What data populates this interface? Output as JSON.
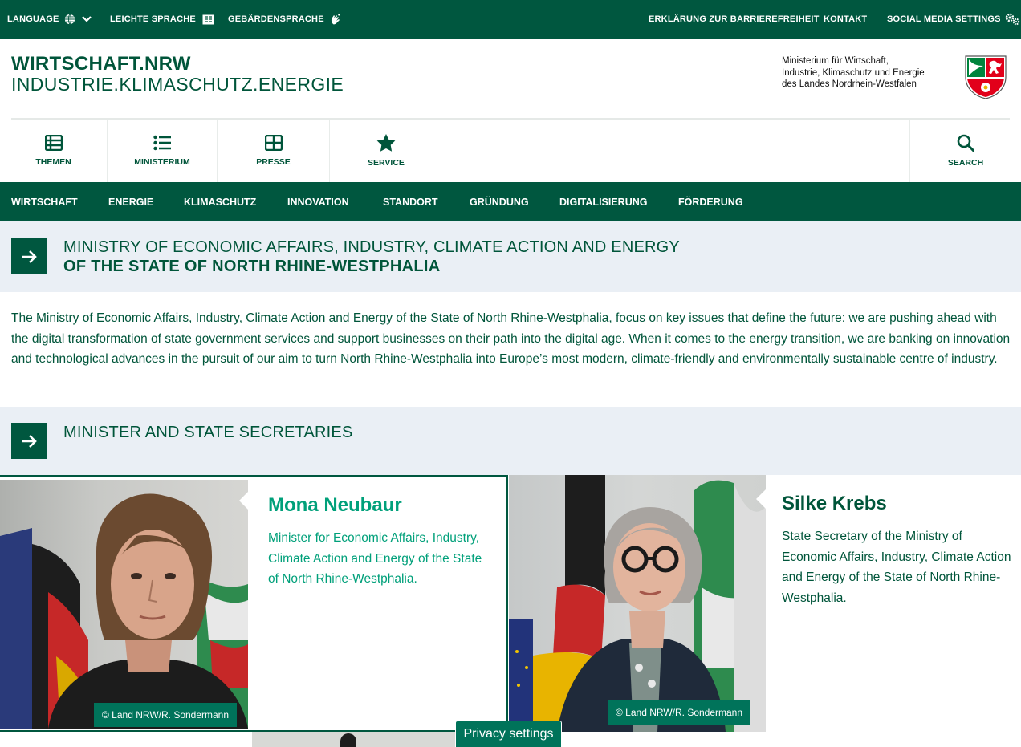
{
  "topbar": {
    "language": "LANGUAGE",
    "easy_language": "LEICHTE SPRACHE",
    "sign_language": "GEBÄRDENSPRACHE",
    "accessibility": "ERKLÄRUNG ZUR BARRIEREFREIHEIT",
    "contact": "KONTAKT",
    "social_media": "SOCIAL MEDIA SETTINGS"
  },
  "header": {
    "brand_line1": "WIRTSCHAFT.NRW",
    "brand_line2": "INDUSTRIE.KLIMASCHUTZ.ENERGIE",
    "ministry_line1": "Ministerium für Wirtschaft,",
    "ministry_line2": "Industrie, Klimaschutz und Energie",
    "ministry_line3": "des Landes Nordrhein-Westfalen"
  },
  "icon_nav": {
    "themen": "THEMEN",
    "ministerium": "MINISTERIUM",
    "presse": "PRESSE",
    "service": "SERVICE",
    "search": "SEARCH"
  },
  "sub_nav": [
    "WIRTSCHAFT",
    "ENERGIE",
    "KLIMASCHUTZ",
    "INNOVATION",
    "STANDORT",
    "GRÜNDUNG",
    "DIGITALISIERUNG",
    "FÖRDERUNG"
  ],
  "section1": {
    "title_line1": "MINISTRY OF ECONOMIC AFFAIRS, INDUSTRY, CLIMATE ACTION AND ENERGY",
    "title_line2": "OF THE STATE OF NORTH RHINE-WESTPHALIA"
  },
  "intro_text": "The Ministry of Economic Affairs, Industry, Climate Action and Energy of the State of North Rhine-Westphalia, focus on key issues that define the future: we are pushing ahead with the digital transformation of state government services and support businesses on their path into the digital age.  When it comes to the energy transition, we are banking on innovation and technological advances in the pursuit of our aim to turn North Rhine-Westphalia into Europe’s most modern, climate-friendly and environmentally sustainable centre of industry.",
  "section2": {
    "title": "MINISTER AND STATE SECRETARIES"
  },
  "people": [
    {
      "name": "Mona Neubaur",
      "role": "Minister for Economic Affairs, Industry, Climate Action and Energy of the State of North Rhine-Westphalia.",
      "credit": "©  Land NRW/R. Sondermann"
    },
    {
      "name": "Silke Krebs",
      "role": "State Secretary of the Ministry of Economic Affairs, Industry, Climate Action and Energy of the State of North Rhine-Westphalia.",
      "credit": "©  Land NRW/R. Sondermann"
    }
  ],
  "privacy_settings": "Privacy settings",
  "colors": {
    "brand_green": "#00573f",
    "accent_green": "#00a07a",
    "section_bg": "#eaeff5"
  }
}
